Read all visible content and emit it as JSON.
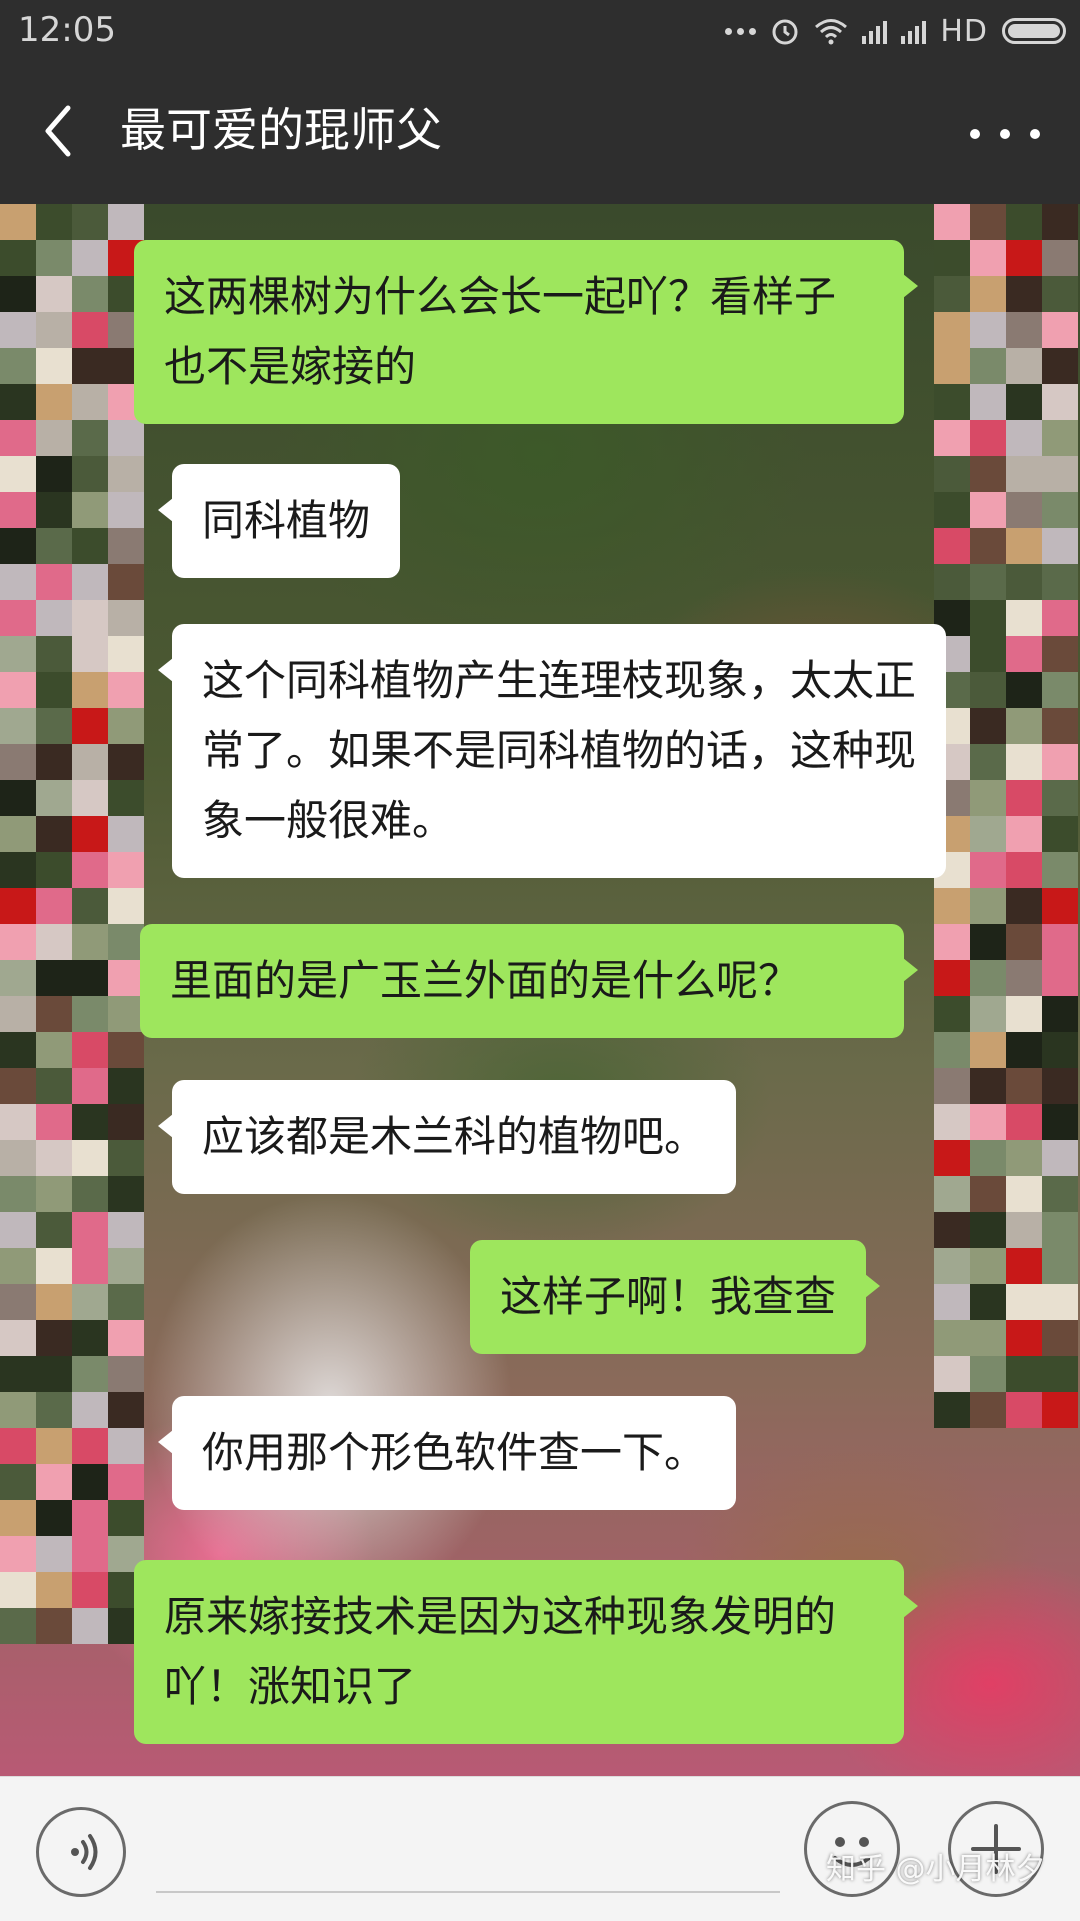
{
  "status_bar": {
    "time": "12:05",
    "network": "HD"
  },
  "header": {
    "title": "最可爱的琨师父"
  },
  "messages": [
    {
      "side": "sent",
      "text": "这两棵树为什么会长一起吖？看样子也不是嫁接的"
    },
    {
      "side": "recv",
      "text": "同科植物"
    },
    {
      "side": "recv",
      "text": "这个同科植物产生连理枝现象，太太正常了。如果不是同科植物的话，这种现象一般很难。"
    },
    {
      "side": "sent",
      "text": "里面的是广玉兰外面的是什么呢？"
    },
    {
      "side": "recv",
      "text": "应该都是木兰科的植物吧。"
    },
    {
      "side": "sent",
      "text": "这样子啊！我查查"
    },
    {
      "side": "recv",
      "text": "你用那个形色软件查一下。"
    },
    {
      "side": "sent",
      "text": "原来嫁接技术是因为这种现象发明的吖！涨知识了"
    }
  ],
  "watermark": "知乎 @小月林夕",
  "colors": {
    "sent_bubble": "#9ee65d",
    "recv_bubble": "#ffffff",
    "title_bar": "#2e2e2e"
  },
  "icons": {
    "back": "chevron-left-icon",
    "more": "more-dots-icon",
    "voice": "voice-icon",
    "emoji": "emoji-icon",
    "plus": "plus-icon"
  }
}
